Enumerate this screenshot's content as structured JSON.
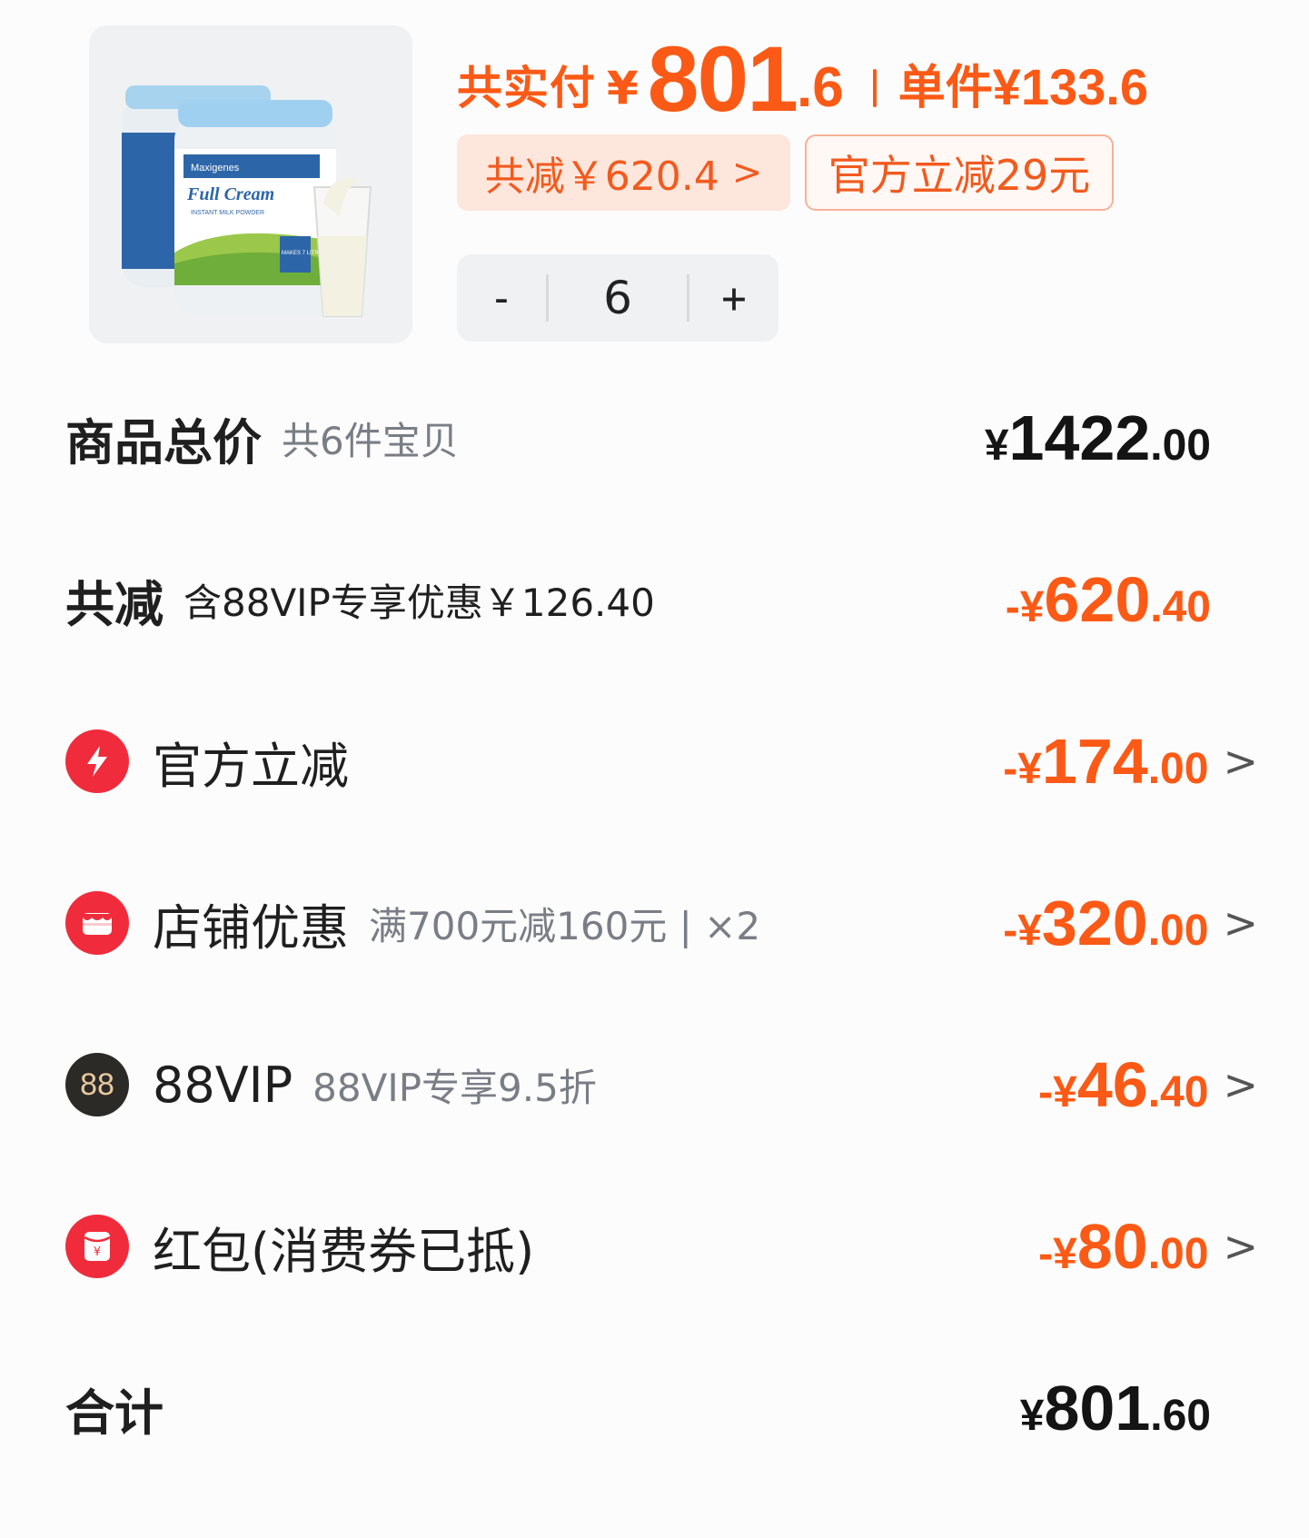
{
  "product": {
    "image_text": {
      "brand": "Maxigenes",
      "title": "Full Cream",
      "subtitle": "INSTANT MILK POWDER",
      "badge": "MAKES 7 LITRES"
    }
  },
  "header": {
    "pay_label": "共实付",
    "pay_currency": "¥",
    "pay_integer": "801",
    "pay_decimal": ".6",
    "unit_label": "单件",
    "unit_price": "¥133.6",
    "total_save_chip": "共减￥620.4",
    "official_chip": "官方立减29元",
    "quantity": "6",
    "minus": "-",
    "plus": "+"
  },
  "rows": {
    "subtotal": {
      "label": "商品总价",
      "note": "共6件宝贝",
      "currency": "¥",
      "integer": "1422",
      "decimal": ".00"
    },
    "total_reduction": {
      "label": "共减",
      "note": "含88VIP专享优惠￥126.40",
      "currency": "-¥",
      "integer": "620",
      "decimal": ".40"
    },
    "official": {
      "label": "官方立减",
      "icon": "lightning-icon",
      "currency": "-¥",
      "integer": "174",
      "decimal": ".00"
    },
    "store": {
      "label": "店铺优惠",
      "icon": "store-icon",
      "note": "满700元减160元 | ×2",
      "currency": "-¥",
      "integer": "320",
      "decimal": ".00"
    },
    "vip": {
      "label": "88VIP",
      "icon": "88vip-icon",
      "icon_text": "88",
      "note": "88VIP专享9.5折",
      "currency": "-¥",
      "integer": "46",
      "decimal": ".40"
    },
    "redpacket": {
      "label": "红包(消费券已抵)",
      "icon": "red-packet-icon",
      "currency": "-¥",
      "integer": "80",
      "decimal": ".00"
    },
    "total": {
      "label": "合计",
      "currency": "¥",
      "integer": "801",
      "decimal": ".60"
    }
  },
  "colors": {
    "accent": "#fb5a16",
    "icon_red": "#f02c3c",
    "vip_dark": "#2c2a27",
    "muted_text": "#7a7d86"
  }
}
